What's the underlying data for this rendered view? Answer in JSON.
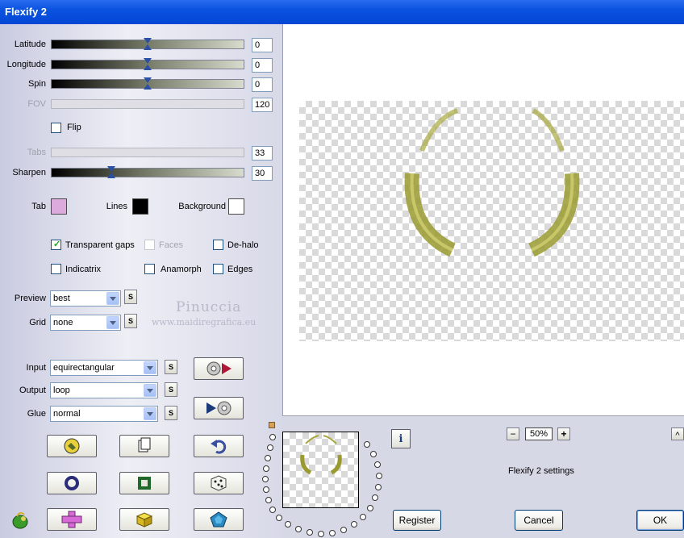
{
  "window": {
    "title": "Flexify 2"
  },
  "sliders": [
    {
      "label": "Latitude",
      "value": "0",
      "enabled": true,
      "level": 0.5
    },
    {
      "label": "Longitude",
      "value": "0",
      "enabled": true,
      "level": 0.5
    },
    {
      "label": "Spin",
      "value": "0",
      "enabled": true,
      "level": 0.5
    },
    {
      "label": "FOV",
      "value": "120",
      "enabled": false
    },
    {
      "label": "Tabs",
      "value": "33",
      "enabled": false
    },
    {
      "label": "Sharpen",
      "value": "30",
      "enabled": true,
      "level": 0.3
    }
  ],
  "flip": {
    "label": "Flip",
    "checked": false
  },
  "colors": {
    "tab": {
      "label": "Tab",
      "hex": "#dcaadc"
    },
    "lines": {
      "label": "Lines",
      "hex": "#000000"
    },
    "background": {
      "label": "Background",
      "hex": "#ffffff"
    }
  },
  "checkboxes": {
    "transparent_gaps": {
      "label": "Transparent gaps",
      "checked": true
    },
    "faces": {
      "label": "Faces",
      "checked": false,
      "enabled": false
    },
    "de_halo": {
      "label": "De-halo",
      "checked": false
    },
    "indicatrix": {
      "label": "Indicatrix",
      "checked": false
    },
    "anamorph": {
      "label": "Anamorph",
      "checked": false
    },
    "edges": {
      "label": "Edges",
      "checked": false
    }
  },
  "preview_select": {
    "label": "Preview",
    "value": "best"
  },
  "grid_select": {
    "label": "Grid",
    "value": "none"
  },
  "input_select": {
    "label": "Input",
    "value": "equirectangular"
  },
  "output_select": {
    "label": "Output",
    "value": "loop"
  },
  "glue_select": {
    "label": "Glue",
    "value": "normal"
  },
  "small_button": "S",
  "watermark": {
    "name": "Pinuccia",
    "url": "www.maidiregrafica.eu"
  },
  "zoom": {
    "minus": "−",
    "value": "50%",
    "plus": "+"
  },
  "settings_label": "Flexify 2 settings",
  "info_label": "i",
  "scroll_up": "^",
  "buttons": {
    "register": "Register",
    "cancel": "Cancel",
    "ok": "OK"
  }
}
